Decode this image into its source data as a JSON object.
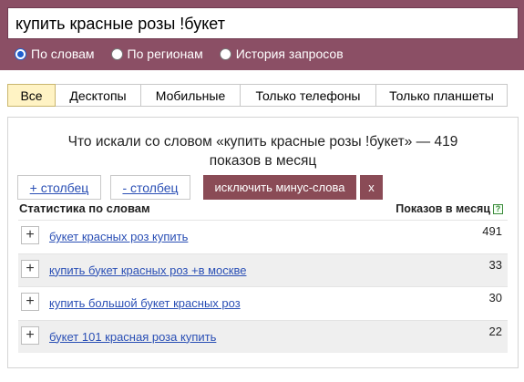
{
  "search": {
    "value": "купить красные розы !букет"
  },
  "modes": [
    {
      "label": "По словам",
      "checked": true
    },
    {
      "label": "По регионам",
      "checked": false
    },
    {
      "label": "История запросов",
      "checked": false
    }
  ],
  "tabs": [
    {
      "label": "Все",
      "active": true
    },
    {
      "label": "Десктопы",
      "active": false
    },
    {
      "label": "Мобильные",
      "active": false
    },
    {
      "label": "Только телефоны",
      "active": false
    },
    {
      "label": "Только планшеты",
      "active": false
    }
  ],
  "panel": {
    "title_line1": "Что искали со словом «купить красные розы !букет» — 419",
    "title_line2": "показов в месяц",
    "add_column": "+ столбец",
    "remove_column": "- столбец",
    "exclude_minus": "исключить минус-слова",
    "close": "x",
    "stats_header": "Статистика по словам",
    "shows_header": "Показов в месяц",
    "help_icon": "?"
  },
  "rows": [
    {
      "phrase": "букет красных роз купить",
      "count": "491"
    },
    {
      "phrase": "купить букет красных роз +в москве",
      "count": "33"
    },
    {
      "phrase": "купить большой букет красных роз",
      "count": "30"
    },
    {
      "phrase": "букет 101 красная роза купить",
      "count": "22"
    }
  ],
  "colors": {
    "band": "#8b4f65",
    "accent_button": "#8a4b56",
    "link": "#2a4fb5",
    "active_tab": "#fff3c4"
  }
}
